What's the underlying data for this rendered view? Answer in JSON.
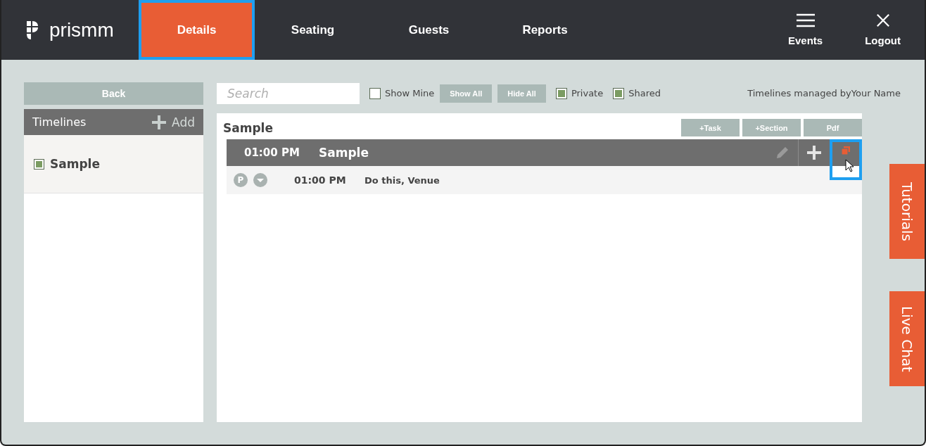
{
  "brand": "prismm",
  "tabs": [
    {
      "label": "Details",
      "selected": true,
      "highlighted": true
    },
    {
      "label": "Seating",
      "selected": false,
      "highlighted": false
    },
    {
      "label": "Guests",
      "selected": false,
      "highlighted": false
    },
    {
      "label": "Reports",
      "selected": false,
      "highlighted": false
    }
  ],
  "header_actions": [
    {
      "kind": "menu",
      "label": "Events"
    },
    {
      "kind": "close",
      "label": "Logout"
    }
  ],
  "sidebar": {
    "back": "Back",
    "title": "Timelines",
    "add": "Add",
    "items": [
      {
        "label": "Sample",
        "checked": true
      }
    ]
  },
  "toolbar": {
    "search": {
      "placeholder": "Search"
    },
    "filters": [
      {
        "kind": "check",
        "label": "Show Mine",
        "checked": false
      },
      {
        "kind": "button",
        "label": "Show All"
      },
      {
        "kind": "button",
        "label": "Hide All"
      },
      {
        "kind": "check",
        "label": "Private",
        "checked": true
      },
      {
        "kind": "check",
        "label": "Shared",
        "checked": true
      }
    ],
    "managed_by": "Timelines managed byYour Name"
  },
  "timeline": {
    "title": "Sample",
    "buttons": [
      "+Task",
      "+Section",
      "Pdf"
    ],
    "sections": [
      {
        "time": "01:00 PM",
        "title": "Sample",
        "copy_highlighted": true,
        "tasks": [
          {
            "badge": "P",
            "time": "01:00 PM",
            "text": "Do this, Venue",
            "expanded": false
          }
        ]
      }
    ]
  },
  "side_tabs": [
    "Tutorials",
    "Live Chat"
  ]
}
